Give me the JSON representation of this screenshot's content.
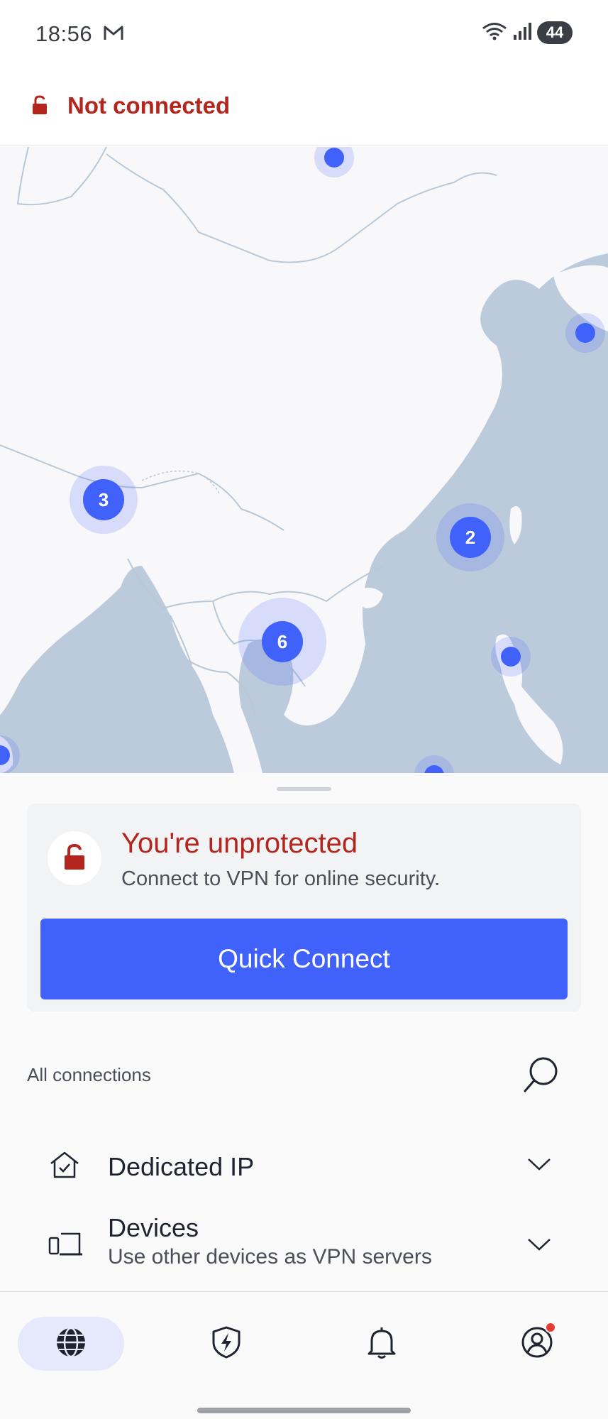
{
  "status_bar": {
    "time": "18:56",
    "battery": "44"
  },
  "connection": {
    "status": "Not connected"
  },
  "map": {
    "clusters": [
      {
        "label": "3"
      },
      {
        "label": "2"
      },
      {
        "label": "6"
      }
    ]
  },
  "card": {
    "title": "You're unprotected",
    "subtitle": "Connect to VPN for online security.",
    "button": "Quick Connect"
  },
  "connections": {
    "header": "All connections",
    "items": [
      {
        "title": "Dedicated IP",
        "subtitle": ""
      },
      {
        "title": "Devices",
        "subtitle": "Use other devices as VPN servers"
      }
    ]
  },
  "colors": {
    "accent": "#4062fb",
    "danger": "#b3261e",
    "land": "#f8f7fa",
    "water": "#bccbdc"
  }
}
